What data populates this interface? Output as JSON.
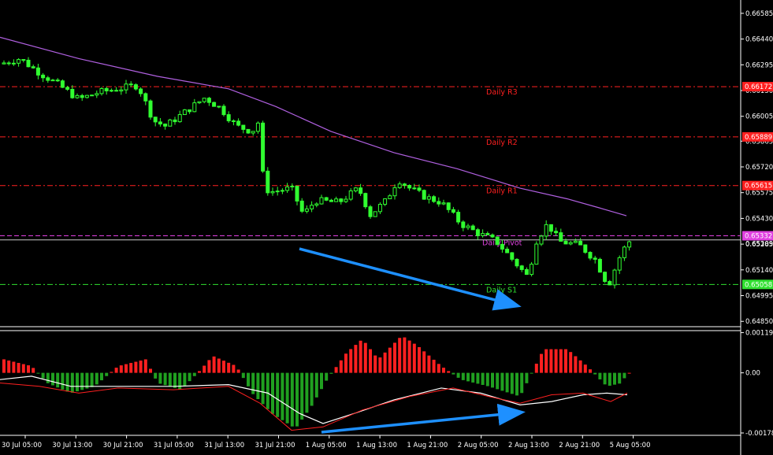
{
  "chart_data": [
    {
      "type": "candlestick",
      "ylim": [
        0.6482,
        0.6666
      ],
      "y_ticks": [
        "0.66585",
        "0.66440",
        "0.66295",
        "0.66150",
        "0.66005",
        "0.65865",
        "0.65720",
        "0.65575",
        "0.65430",
        "0.65285",
        "0.65140",
        "0.64995",
        "0.64850"
      ],
      "x_ticks": [
        "30 Jul 05:00",
        "30 Jul 13:00",
        "30 Jul 21:00",
        "31 Jul 05:00",
        "31 Jul 13:00",
        "31 Jul 21:00",
        "1 Aug 05:00",
        "1 Aug 13:00",
        "1 Aug 21:00",
        "2 Aug 05:00",
        "2 Aug 13:00",
        "2 Aug 21:00",
        "5 Aug 05:00"
      ],
      "levels": [
        {
          "name": "Daily R3",
          "value": 0.66172,
          "color": "#ff2020"
        },
        {
          "name": "Daily R2",
          "value": 0.65889,
          "color": "#ff2020"
        },
        {
          "name": "Daily R1",
          "value": 0.65615,
          "color": "#ff2020"
        },
        {
          "name": "Daily Pivot",
          "value": 0.65332,
          "color": "#e040e0"
        },
        {
          "name": "Daily S1",
          "value": 0.65058,
          "color": "#30e030"
        }
      ],
      "level_labels": [
        "0.66172",
        "0.65889",
        "0.65615",
        "0.65332",
        "0.65058"
      ],
      "current_price": 0.65309,
      "current_price_label": "0.65309",
      "candle_color": "#30ff30",
      "ma_color": "#b060e0",
      "arrow_color": "#1e90ff"
    },
    {
      "type": "bar",
      "ylim": [
        -0.00185,
        0.00125
      ],
      "y_ticks": [
        "0.00119",
        "0.00",
        "-0.00178"
      ],
      "up_color": "#ff2020",
      "down_color": "#20a020",
      "signal_color": "#ffffff",
      "line2_color": "#ff2020"
    }
  ]
}
